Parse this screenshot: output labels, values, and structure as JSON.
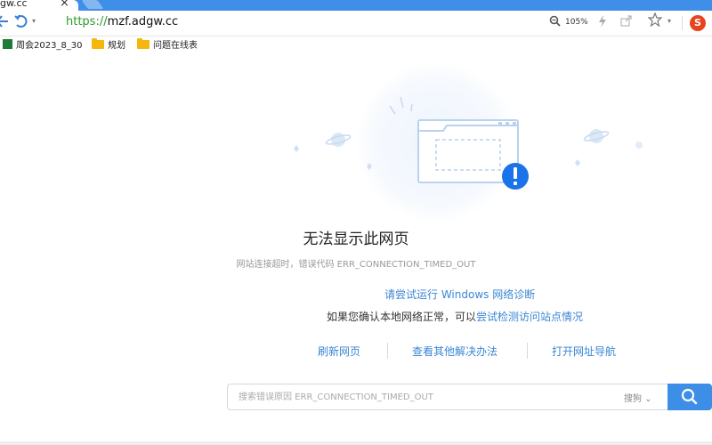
{
  "tab": {
    "title": "gw.cc",
    "close": "×"
  },
  "toolbar": {
    "back_icon": "arrow-back-icon",
    "undo_icon": "undo-icon",
    "dropdown": "▾",
    "url_scheme": "https://",
    "url_host": "mzf.adgw.cc",
    "zoom": "105%",
    "browser_logo": "S"
  },
  "bookmarks": [
    {
      "label": "周会2023_8_30",
      "icon": "spreadsheet-icon"
    },
    {
      "label": "规划",
      "icon": "folder-icon"
    },
    {
      "label": "问题在线表",
      "icon": "folder-icon"
    }
  ],
  "error": {
    "title": "无法显示此网页",
    "subtitle": "网站连接超时，错误代码 ERR_CONNECTION_TIMED_OUT",
    "diagnose_link": "请尝试运行 Windows 网络诊断",
    "check_prefix": "如果您确认本地网络正常，可以",
    "check_link": "尝试检测访问站点情况"
  },
  "actions": {
    "refresh": "刷新网页",
    "other_solutions": "查看其他解决办法",
    "open_nav": "打开网址导航"
  },
  "search": {
    "placeholder": "搜索错误原因 ERR_CONNECTION_TIMED_OUT",
    "engine": "搜狗",
    "engine_caret": "⌄"
  },
  "colors": {
    "accent": "#3b86d4",
    "tabstrip": "#3f8ee8",
    "error_badge": "#1a73e8",
    "search_button": "#3d8ee6"
  }
}
